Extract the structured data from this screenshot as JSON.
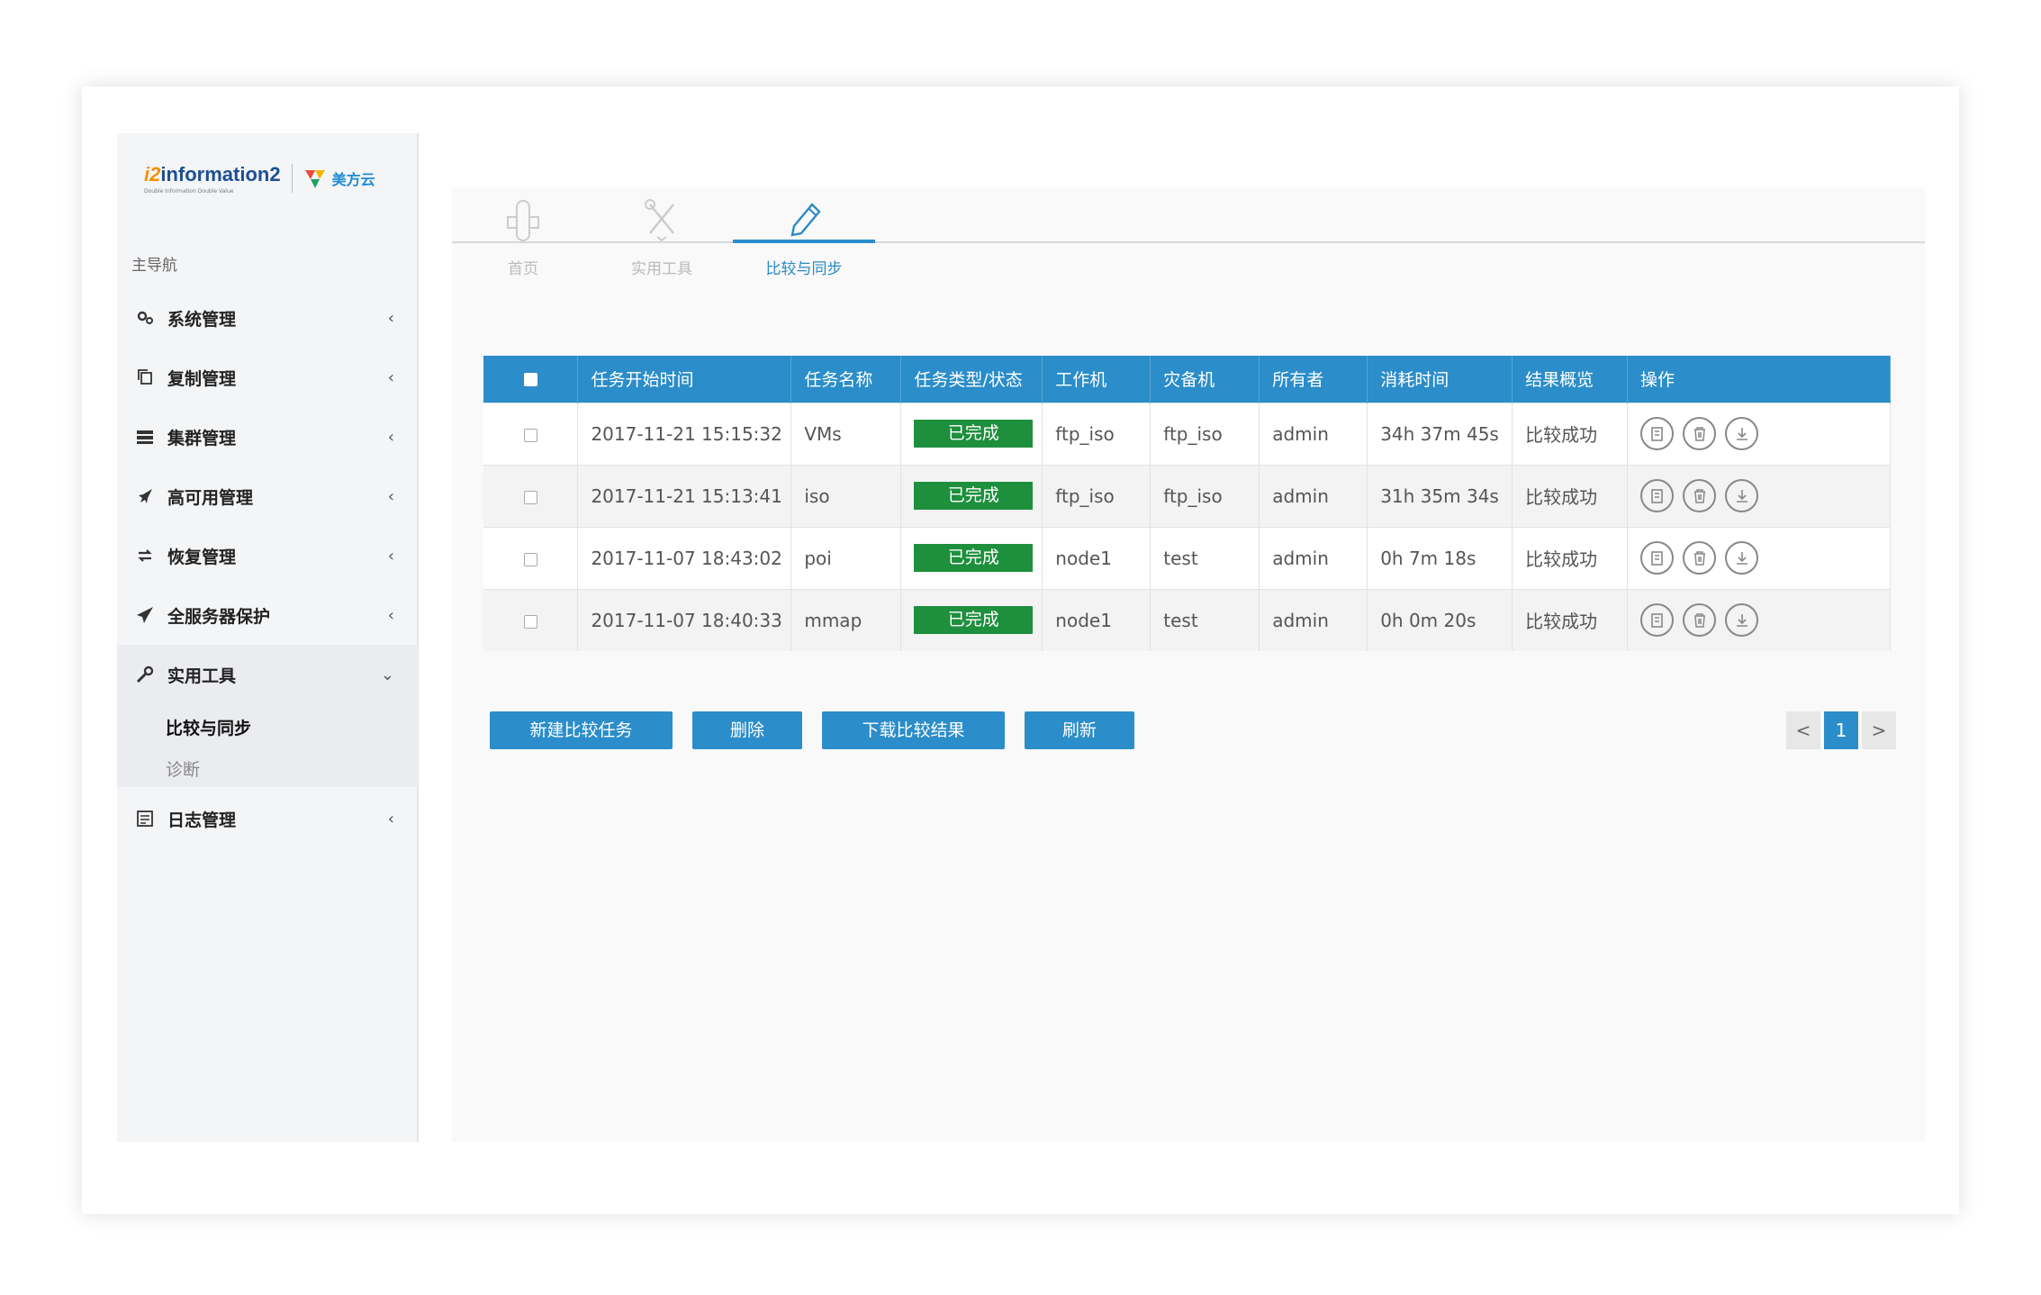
{
  "logo": {
    "brand_text": "information2",
    "brand_prefix": "i2",
    "tagline": "Double Information Double Value",
    "partner": "美方云"
  },
  "nav": {
    "heading": "主导航",
    "items": [
      {
        "label": "系统管理",
        "icon": "gears-icon"
      },
      {
        "label": "复制管理",
        "icon": "copy-icon"
      },
      {
        "label": "集群管理",
        "icon": "server-icon"
      },
      {
        "label": "高可用管理",
        "icon": "rocket-icon"
      },
      {
        "label": "恢复管理",
        "icon": "restore-icon"
      },
      {
        "label": "全服务器保护",
        "icon": "plane-icon"
      },
      {
        "label": "实用工具",
        "icon": "wrench-icon"
      },
      {
        "label": "日志管理",
        "icon": "log-icon"
      }
    ],
    "sub_items": [
      "比较与同步",
      "诊断"
    ]
  },
  "tabs": [
    {
      "label": "首页",
      "icon": "home-icon"
    },
    {
      "label": "实用工具",
      "icon": "tools-icon"
    },
    {
      "label": "比较与同步",
      "icon": "pencil-icon"
    }
  ],
  "table": {
    "headers": [
      "任务开始时间",
      "任务名称",
      "任务类型/状态",
      "工作机",
      "灾备机",
      "所有者",
      "消耗时间",
      "结果概览",
      "操作"
    ],
    "rows": [
      {
        "start": "2017-11-21 15:15:32",
        "name": "VMs",
        "status": "已完成",
        "work": "ftp_iso",
        "backup": "ftp_iso",
        "owner": "admin",
        "elapsed": "34h 37m 45s",
        "result": "比较成功"
      },
      {
        "start": "2017-11-21 15:13:41",
        "name": "iso",
        "status": "已完成",
        "work": "ftp_iso",
        "backup": "ftp_iso",
        "owner": "admin",
        "elapsed": "31h 35m 34s",
        "result": "比较成功"
      },
      {
        "start": "2017-11-07 18:43:02",
        "name": "poi",
        "status": "已完成",
        "work": "node1",
        "backup": "test",
        "owner": "admin",
        "elapsed": "0h 7m 18s",
        "result": "比较成功"
      },
      {
        "start": "2017-11-07 18:40:33",
        "name": "mmap",
        "status": "已完成",
        "work": "node1",
        "backup": "test",
        "owner": "admin",
        "elapsed": "0h 0m 20s",
        "result": "比较成功"
      }
    ]
  },
  "buttons": {
    "new": "新建比较任务",
    "delete": "删除",
    "download": "下载比较结果",
    "refresh": "刷新"
  },
  "pager": {
    "prev": "<",
    "current": "1",
    "next": ">"
  },
  "colors": {
    "accent": "#2b8dc9",
    "status_done": "#1e8f3c"
  }
}
